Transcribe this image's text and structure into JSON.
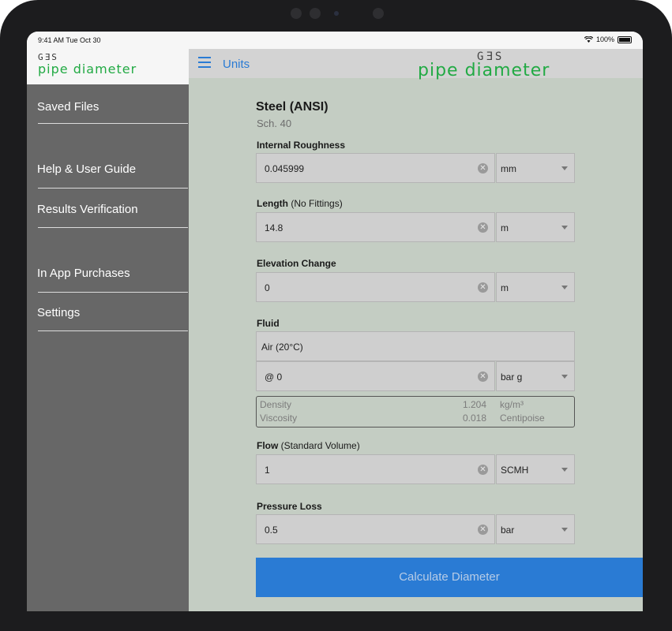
{
  "status_bar": {
    "time": "9:41 AM  Tue Oct 30",
    "wifi": "wifi-icon",
    "battery": "100%"
  },
  "sidebar": {
    "logo_gas": "GƎS",
    "logo_pipe": "pipe diameter",
    "items": [
      {
        "label": "Saved Files"
      },
      {
        "label": "Help & User Guide"
      },
      {
        "label": "Results Verification"
      },
      {
        "label": "In App Purchases"
      },
      {
        "label": "Settings"
      }
    ]
  },
  "navbar": {
    "menu_icon": "hamburger-icon",
    "units_label": "Units",
    "logo_gas": "GƎS",
    "logo_pipe": "pipe diameter"
  },
  "material": {
    "title": "Steel (ANSI)",
    "schedule": "Sch. 40"
  },
  "fields": {
    "roughness": {
      "label": "Internal Roughness",
      "value": "0.045999",
      "unit": "mm"
    },
    "length": {
      "label": "Length",
      "note": "(No Fittings)",
      "value": "14.8",
      "unit": "m"
    },
    "elevation": {
      "label": "Elevation Change",
      "value": "0",
      "unit": "m"
    },
    "fluid": {
      "label": "Fluid",
      "name": "Air (20°C)",
      "pressure_value": "@ 0",
      "pressure_unit": "bar g",
      "density_label": "Density",
      "density_value": "1.204",
      "density_unit": "kg/m³",
      "viscosity_label": "Viscosity",
      "viscosity_value": "0.018",
      "viscosity_unit": "Centipoise"
    },
    "flow": {
      "label": "Flow",
      "note": "(Standard Volume)",
      "value": "1",
      "unit": "SCMH"
    },
    "pressure_loss": {
      "label": "Pressure Loss",
      "value": "0.5",
      "unit": "bar"
    }
  },
  "calculate_button": "Calculate Diameter",
  "colors": {
    "accent": "#2a7bd4",
    "brand_green": "#22aa44",
    "sidebar_bg": "#676767",
    "content_bg": "#c4cdc3"
  }
}
